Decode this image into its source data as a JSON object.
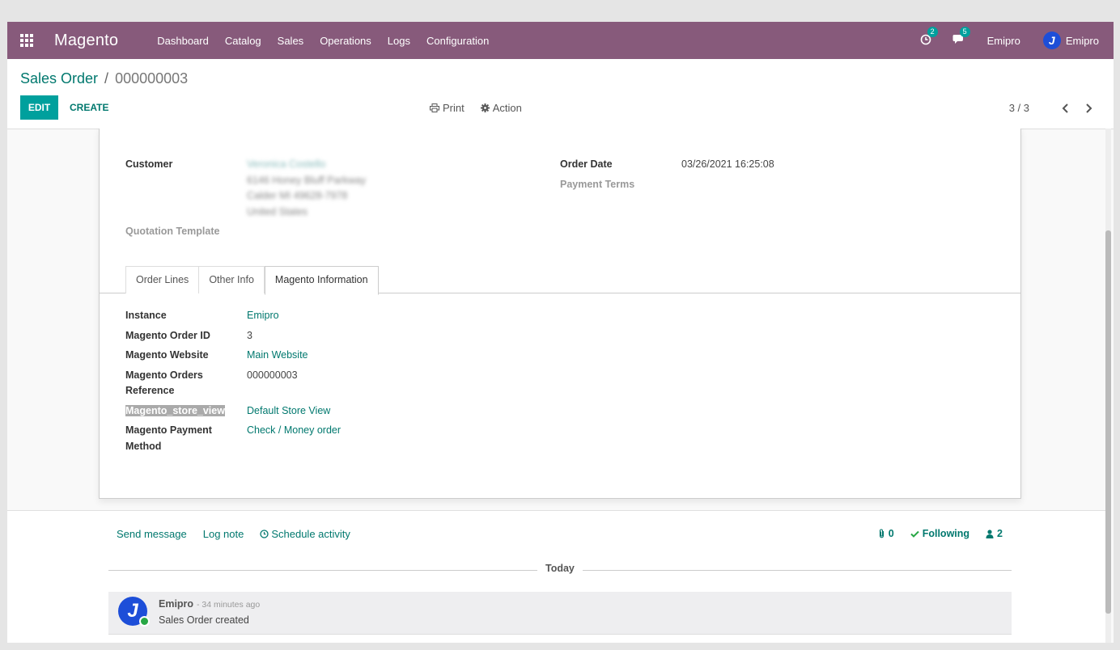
{
  "navbar": {
    "brand": "Magento",
    "menu": [
      "Dashboard",
      "Catalog",
      "Sales",
      "Operations",
      "Logs",
      "Configuration"
    ],
    "activity_count": "2",
    "message_count": "5",
    "company": "Emipro",
    "user_name": "Emipro",
    "avatar_letter": "J"
  },
  "control_panel": {
    "breadcrumb_parent": "Sales Order",
    "breadcrumb_separator": "/",
    "breadcrumb_current": "000000003",
    "edit_label": "EDIT",
    "create_label": "CREATE",
    "print_label": "Print",
    "action_label": "Action",
    "pager": "3 / 3"
  },
  "form": {
    "customer_label": "Customer",
    "customer_name": "Veronica Costello",
    "customer_address": [
      "6146 Honey Bluff Parkway",
      "Calder MI 49628-7978",
      "United States"
    ],
    "quotation_template_label": "Quotation Template",
    "order_date_label": "Order Date",
    "order_date": "03/26/2021 16:25:08",
    "payment_terms_label": "Payment Terms",
    "tabs": [
      "Order Lines",
      "Other Info",
      "Magento Information"
    ],
    "active_tab": "Magento Information",
    "fields": {
      "instance_label": "Instance",
      "instance": "Emipro",
      "order_id_label": "Magento Order ID",
      "order_id": "3",
      "website_label": "Magento Website",
      "website": "Main Website",
      "orders_ref_label_1": "Magento Orders",
      "orders_ref_label_2": "Reference",
      "orders_ref": "000000003",
      "store_view_label": "Magento_store_view",
      "store_view": "Default Store View",
      "payment_label_1": "Magento Payment",
      "payment_label_2": "Method",
      "payment": "Check / Money order"
    }
  },
  "chatter": {
    "send_message": "Send message",
    "log_note": "Log note",
    "schedule_activity": "Schedule activity",
    "attachments": "0",
    "following": "Following",
    "followers": "2",
    "today": "Today",
    "message_author": "Emipro",
    "message_date": "- 34 minutes ago",
    "message_body": "Sales Order created",
    "avatar_letter": "J"
  },
  "colors": {
    "navbar": "#875a7b",
    "primary": "#00a09d",
    "link": "#00786e",
    "badge": "#00a09d"
  }
}
